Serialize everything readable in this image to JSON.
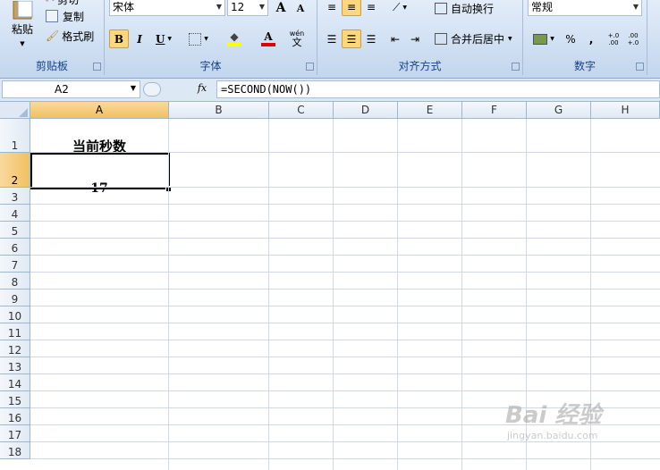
{
  "ribbon": {
    "clipboard": {
      "label": "剪贴板",
      "paste": "粘贴",
      "cut": "剪切",
      "copy": "复制",
      "format_painter": "格式刷"
    },
    "font": {
      "label": "字体",
      "font_name": "宋体",
      "font_size": "12",
      "bold": "B",
      "italic": "I",
      "underline": "U",
      "grow": "A",
      "shrink": "A",
      "font_color": "A",
      "phonetic": "wén"
    },
    "alignment": {
      "label": "对齐方式",
      "wrap_text": "自动换行",
      "merge_center": "合并后居中"
    },
    "number": {
      "label": "数字",
      "format": "常规",
      "percent": "%",
      "comma": ",",
      "inc_decimal": "+.0 .00",
      "dec_decimal": ".00 +.0"
    }
  },
  "formula_bar": {
    "name_box": "A2",
    "fx": "fx",
    "formula": "=SECOND(NOW())"
  },
  "sheet": {
    "columns": [
      "A",
      "B",
      "C",
      "D",
      "E",
      "F",
      "G",
      "H"
    ],
    "rows": [
      "1",
      "2",
      "3",
      "4",
      "5",
      "6",
      "7",
      "8",
      "9",
      "10",
      "11",
      "12",
      "13",
      "14",
      "15",
      "16",
      "17",
      "18"
    ],
    "a1": "当前秒数",
    "a2": "17",
    "selected_cell": "A2"
  },
  "watermark": {
    "brand": "Bai 经验",
    "url": "jingyan.baidu.com"
  }
}
